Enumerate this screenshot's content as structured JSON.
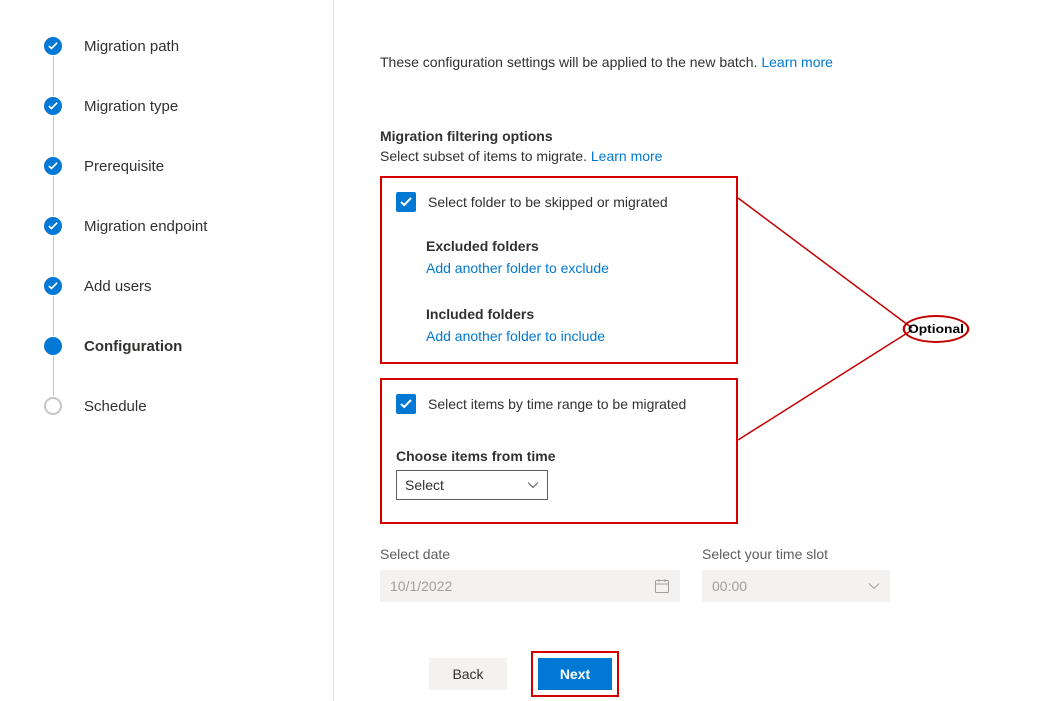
{
  "sidebar": {
    "steps": [
      {
        "label": "Migration path",
        "state": "done"
      },
      {
        "label": "Migration type",
        "state": "done"
      },
      {
        "label": "Prerequisite",
        "state": "done"
      },
      {
        "label": "Migration endpoint",
        "state": "done"
      },
      {
        "label": "Add users",
        "state": "done"
      },
      {
        "label": "Configuration",
        "state": "current"
      },
      {
        "label": "Schedule",
        "state": "pending"
      }
    ]
  },
  "main": {
    "intro_text": "These configuration settings will be applied to the new batch. ",
    "intro_link": "Learn more",
    "filter_heading": "Migration filtering options",
    "filter_sub_text": "Select subset of items to migrate. ",
    "filter_sub_link": "Learn more",
    "cb_folder_label": "Select folder to be skipped or migrated",
    "excluded_heading": "Excluded folders",
    "excluded_link": "Add another folder to exclude",
    "included_heading": "Included folders",
    "included_link": "Add another folder to include",
    "cb_time_label": "Select items by time range to be migrated",
    "choose_time_heading": "Choose items from time",
    "select_placeholder": "Select",
    "date_label": "Select date",
    "date_value": "10/1/2022",
    "slot_label": "Select your time slot",
    "slot_value": "00:00"
  },
  "footer": {
    "back": "Back",
    "next": "Next"
  },
  "annotation": {
    "ellipse_text": "Optional"
  }
}
